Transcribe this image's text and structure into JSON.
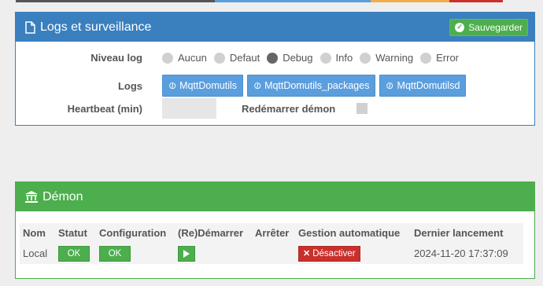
{
  "colors": {
    "primary": "#3a7fbe",
    "success": "#4cae4c",
    "danger": "#c9302c",
    "link_button": "#5b9ede"
  },
  "logs_panel": {
    "title": "Logs et surveillance",
    "title_icon": "file-icon",
    "save_label": "Sauvegarder",
    "log_level": {
      "label": "Niveau log",
      "options": [
        "Aucun",
        "Defaut",
        "Debug",
        "Info",
        "Warning",
        "Error"
      ],
      "selected": "Debug"
    },
    "logs": {
      "label": "Logs",
      "files": [
        "MqttDomutils",
        "MqttDomutils_packages",
        "MqttDomutilsd"
      ]
    },
    "heartbeat": {
      "label": "Heartbeat (min)",
      "value": ""
    },
    "restart_daemon": {
      "label": "Redémarrer démon",
      "checked": false
    }
  },
  "daemon_panel": {
    "title": "Démon",
    "title_icon": "bank-icon",
    "headers": [
      "Nom",
      "Statut",
      "Configuration",
      "(Re)Démarrer",
      "Arrêter",
      "Gestion automatique",
      "Dernier lancement"
    ],
    "row": {
      "name": "Local",
      "status": "OK",
      "configuration": "OK",
      "deactivate_label": "Désactiver",
      "last_launch": "2024-11-20 17:37:09"
    }
  }
}
